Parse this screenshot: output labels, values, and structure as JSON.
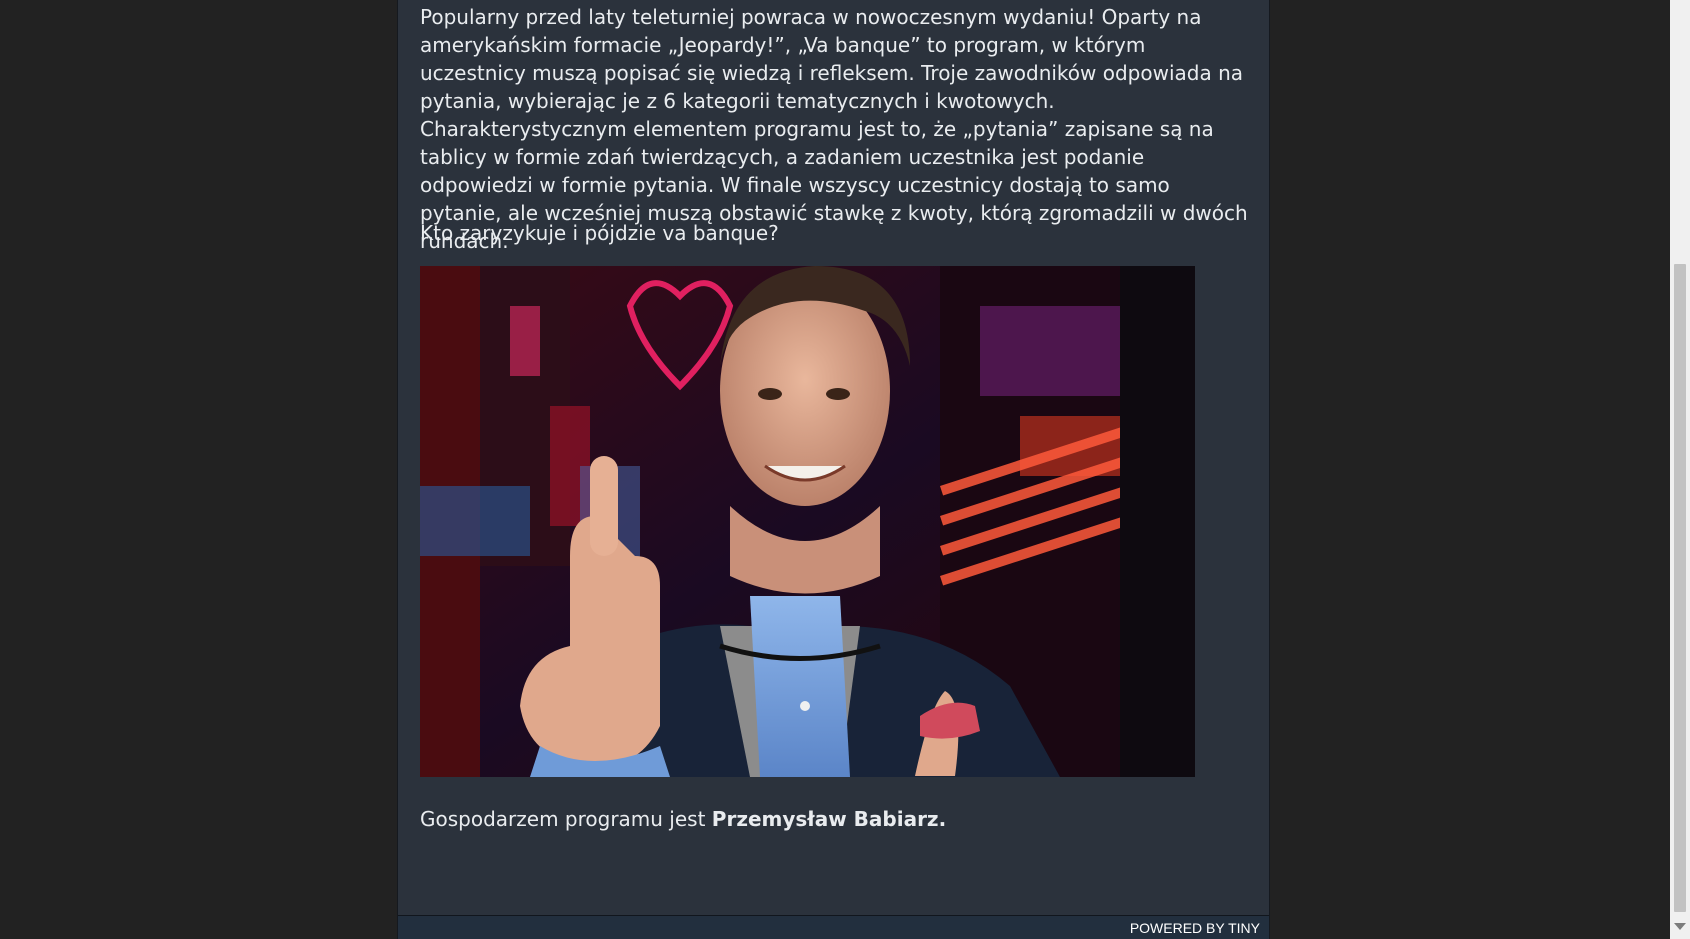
{
  "editor": {
    "paragraph_intro": "Popularny przed laty teleturniej powraca w nowoczesnym wydaniu! Oparty na amerykańskim formacie „Jeopardy!”, „Va banque” to program, w którym uczestnicy muszą popisać się wiedzą i refleksem. Troje zawodników odpowiada na pytania, wybierając je z 6 kategorii tematycznych i kwotowych. Charakterystycznym elementem programu jest to, że „pytania” zapisane są na tablicy w formie zdań twierdzących, a zadaniem uczestnika jest podanie odpowiedzi w formie pytania. W finale wszyscy uczestnicy dostają to samo pytanie, ale wcześniej muszą obstawić stawkę z kwoty, którą zgromadzili w dwóch rundach.",
    "paragraph_question": "Kto zaryzykuje i pójdzie va banque?",
    "host_prefix": "Gospodarzem programu jest ",
    "host_name": "Przemysław Babiarz."
  },
  "statusbar": {
    "powered_by": "POWERED BY TINY"
  },
  "colors": {
    "page_background": "#222222",
    "editor_background": "#2b323c",
    "text": "#e9ecef",
    "statusbar_background": "#222f3e"
  }
}
